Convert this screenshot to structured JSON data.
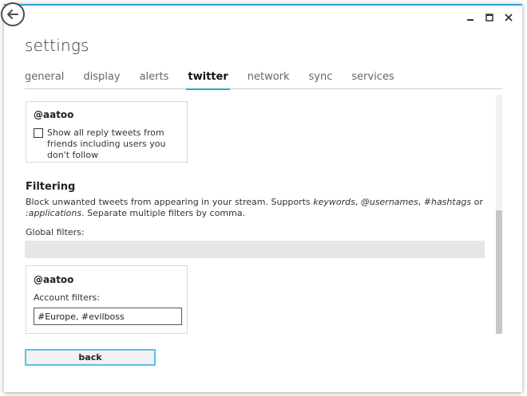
{
  "window": {
    "title": "settings",
    "controls": {
      "minimize": "–",
      "maximize": "□",
      "close": "✕"
    }
  },
  "tabs": [
    {
      "label": "general"
    },
    {
      "label": "display"
    },
    {
      "label": "alerts"
    },
    {
      "label": "twitter",
      "active": true
    },
    {
      "label": "network"
    },
    {
      "label": "sync"
    },
    {
      "label": "services"
    }
  ],
  "replies_card": {
    "account": "@aatoo",
    "checkbox_label": "Show all reply tweets from friends including users you don't follow",
    "checked": false
  },
  "filtering": {
    "heading": "Filtering",
    "description_lead": "Block unwanted tweets from appearing in your stream. Supports ",
    "kw_keywords": "keywords",
    "sep1": ", ",
    "kw_usernames": "@usernames",
    "sep2": ", ",
    "kw_hashtags": "#hashtags",
    "sep3": " or ",
    "kw_applications": ":applications",
    "description_tail": ". Separate multiple filters by comma.",
    "global_label": "Global filters:",
    "global_value": ""
  },
  "account_card": {
    "account": "@aatoo",
    "filters_label": "Account filters:",
    "filters_value": "#Europe, #evilboss"
  },
  "footer": {
    "back_label": "back"
  },
  "accent_color": "#2fa3d6",
  "scroll_position": 0.72
}
